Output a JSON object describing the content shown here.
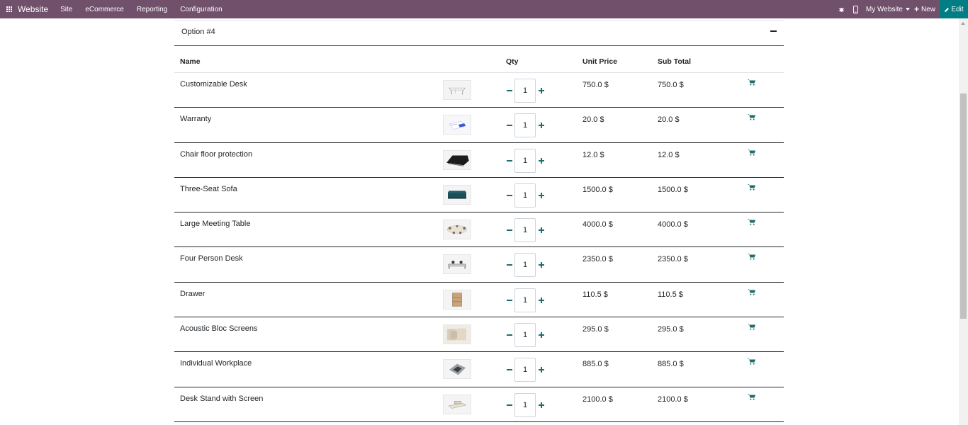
{
  "navbar": {
    "brand": "Website",
    "menu": [
      "Site",
      "eCommerce",
      "Reporting",
      "Configuration"
    ],
    "my_website": "My Website",
    "new_label": "New",
    "edit_label": "Edit",
    "icons": [
      "apps-icon",
      "bug-icon",
      "mobile-icon",
      "plus-icon",
      "pencil-icon"
    ]
  },
  "option": {
    "title": "Option #4"
  },
  "table": {
    "headers": {
      "name": "Name",
      "qty": "Qty",
      "unit_price": "Unit Price",
      "sub_total": "Sub Total"
    },
    "rows": [
      {
        "name": "Customizable Desk",
        "qty": "1",
        "unit_price": "750.0 $",
        "sub_total": "750.0 $",
        "image": "desk"
      },
      {
        "name": "Warranty",
        "qty": "1",
        "unit_price": "20.0 $",
        "sub_total": "20.0 $",
        "image": "warranty"
      },
      {
        "name": "Chair floor protection",
        "qty": "1",
        "unit_price": "12.0 $",
        "sub_total": "12.0 $",
        "image": "mat"
      },
      {
        "name": "Three-Seat Sofa",
        "qty": "1",
        "unit_price": "1500.0 $",
        "sub_total": "1500.0 $",
        "image": "sofa"
      },
      {
        "name": "Large Meeting Table",
        "qty": "1",
        "unit_price": "4000.0 $",
        "sub_total": "4000.0 $",
        "image": "table"
      },
      {
        "name": "Four Person Desk",
        "qty": "1",
        "unit_price": "2350.0 $",
        "sub_total": "2350.0 $",
        "image": "fourdesk"
      },
      {
        "name": "Drawer",
        "qty": "1",
        "unit_price": "110.5 $",
        "sub_total": "110.5 $",
        "image": "drawer"
      },
      {
        "name": "Acoustic Bloc Screens",
        "qty": "1",
        "unit_price": "295.0 $",
        "sub_total": "295.0 $",
        "image": "screens"
      },
      {
        "name": "Individual Workplace",
        "qty": "1",
        "unit_price": "885.0 $",
        "sub_total": "885.0 $",
        "image": "workplace"
      },
      {
        "name": "Desk Stand with Screen",
        "qty": "1",
        "unit_price": "2100.0 $",
        "sub_total": "2100.0 $",
        "image": "stand"
      }
    ]
  },
  "colors": {
    "navbar": "#71506b",
    "edit": "#017e84",
    "accent": "#1f6d6d"
  }
}
